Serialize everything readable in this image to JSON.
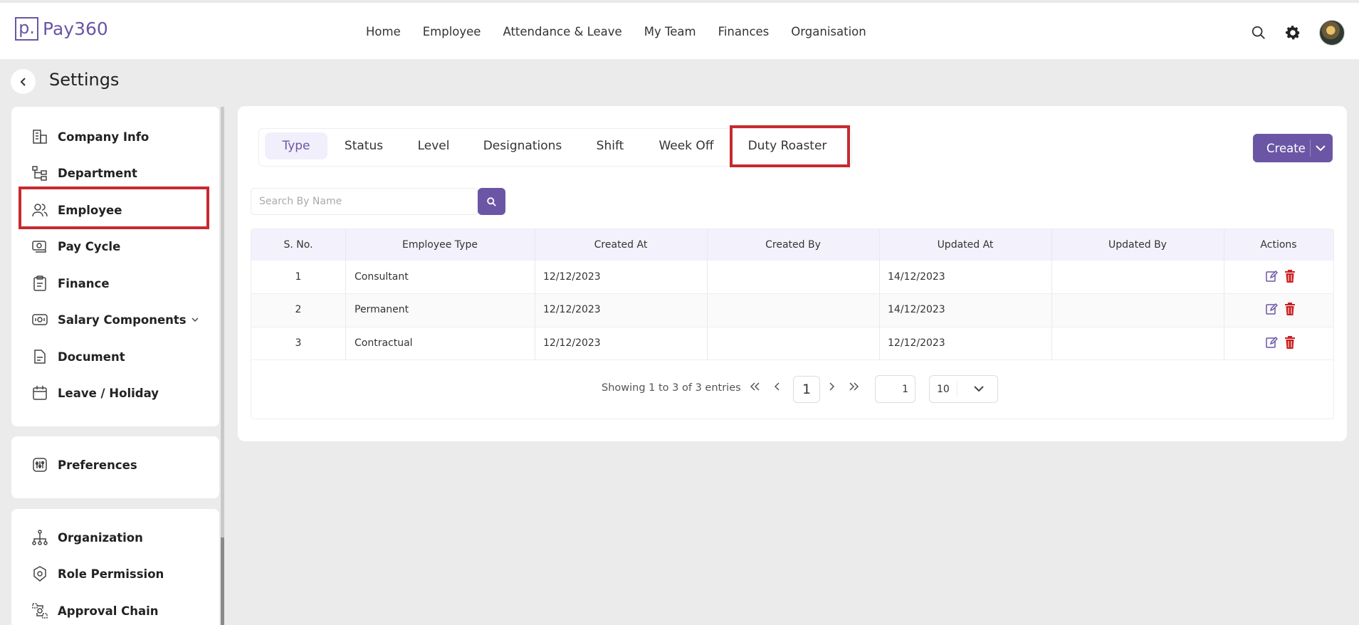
{
  "app": {
    "logo_mark": "p.",
    "name": "Pay360"
  },
  "nav": [
    "Home",
    "Employee",
    "Attendance & Leave",
    "My Team",
    "Finances",
    "Organisation"
  ],
  "header": {
    "title": "Settings"
  },
  "sidebar": {
    "group1": [
      "Company Info",
      "Department",
      "Employee",
      "Pay Cycle",
      "Finance",
      "Salary Components",
      "Document",
      "Leave / Holiday"
    ],
    "group2": [
      "Preferences"
    ],
    "group3": [
      "Organization",
      "Role Permission",
      "Approval Chain"
    ]
  },
  "tabs": [
    "Type",
    "Status",
    "Level",
    "Designations",
    "Shift",
    "Week Off",
    "Duty Roaster"
  ],
  "create_label": "Create",
  "search": {
    "placeholder": "Search By Name"
  },
  "table": {
    "headers": [
      "S. No.",
      "Employee Type",
      "Created At",
      "Created By",
      "Updated At",
      "Updated By",
      "Actions"
    ],
    "rows": [
      [
        "1",
        "Consultant",
        "12/12/2023",
        "",
        "14/12/2023",
        ""
      ],
      [
        "2",
        "Permanent",
        "12/12/2023",
        "",
        "14/12/2023",
        ""
      ],
      [
        "3",
        "Contractual",
        "12/12/2023",
        "",
        "12/12/2023",
        ""
      ]
    ]
  },
  "pagination": {
    "info": "Showing 1 to 3 of 3 entries",
    "first": "«",
    "prev": "‹",
    "next": "›",
    "last": "»",
    "current_page": "1",
    "goto_page": "1",
    "page_size": "10"
  },
  "colors": {
    "accent": "#6a56a5",
    "highlight": "#c62a30",
    "delete": "#cc1f1f"
  }
}
